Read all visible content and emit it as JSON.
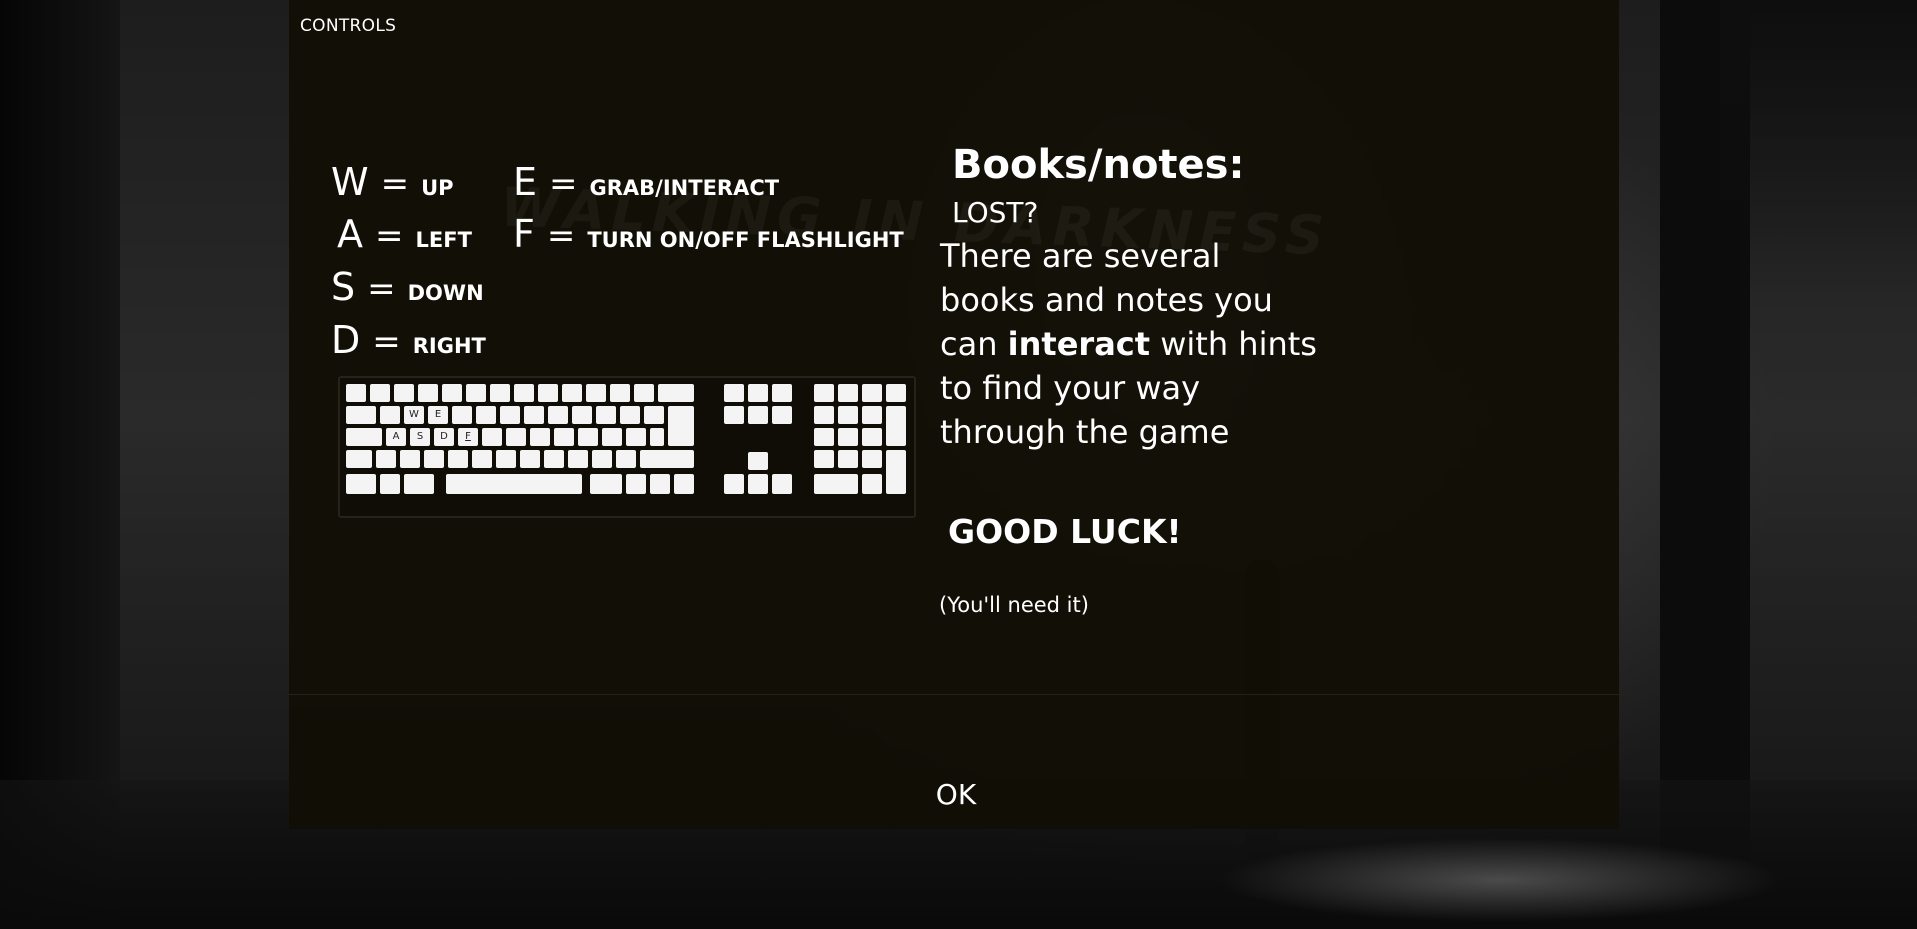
{
  "dialog": {
    "title": "CONTROLS",
    "watermark": "WALKING IN DARKNESS"
  },
  "controls": [
    {
      "key": "W",
      "action": "UP"
    },
    {
      "key": "A",
      "action": "LEFT"
    },
    {
      "key": "S",
      "action": "DOWN"
    },
    {
      "key": "D",
      "action": "RIGHT"
    },
    {
      "key": "E",
      "action": "GRAB/INTERACT"
    },
    {
      "key": "F",
      "action": "TURN ON/OFF FLASHLIGHT"
    }
  ],
  "keyboard": {
    "labels": {
      "w": "W",
      "e": "E",
      "a": "A",
      "s": "S",
      "d": "D",
      "f": "F"
    }
  },
  "notes": {
    "title": "Books/notes:",
    "subtitle": "LOST?",
    "body_before": "There are several books and notes you can ",
    "body_bold": "interact",
    "body_after": " with hints to find your way through the game",
    "good_luck": "GOOD LUCK!",
    "footnote": "(You'll need it)"
  },
  "buttons": {
    "ok": "OK"
  }
}
